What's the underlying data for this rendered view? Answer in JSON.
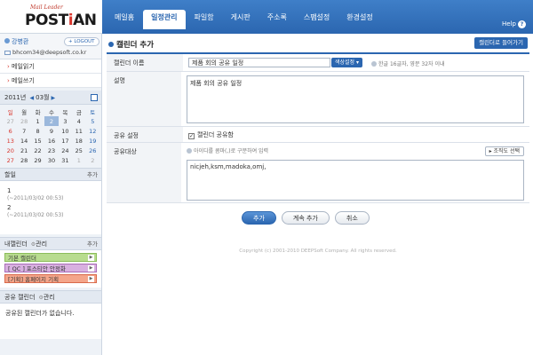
{
  "brand": {
    "tagline": "Mail Leader",
    "name_part1": "POST",
    "name_part2": "i",
    "name_part3": "AN"
  },
  "nav": {
    "items": [
      "메일홈",
      "일정관리",
      "파일함",
      "게시판",
      "주소록",
      "스팸설정",
      "환경설정"
    ],
    "active": "일정관리",
    "help": "Help"
  },
  "user": {
    "name": "강병환",
    "logout": "LOGOUT",
    "email": "bhcom34@deepsoft.co.kr"
  },
  "sidebar": {
    "links": [
      "메일읽기",
      "메일쓰기"
    ],
    "calendar": {
      "year": "2011년",
      "month": "03월",
      "weekdays": [
        "일",
        "월",
        "화",
        "수",
        "목",
        "금",
        "토"
      ],
      "weeks": [
        [
          "27",
          "28",
          "1",
          "2",
          "3",
          "4",
          "5"
        ],
        [
          "6",
          "7",
          "8",
          "9",
          "10",
          "11",
          "12"
        ],
        [
          "13",
          "14",
          "15",
          "16",
          "17",
          "18",
          "19"
        ],
        [
          "20",
          "21",
          "22",
          "23",
          "24",
          "25",
          "26"
        ],
        [
          "27",
          "28",
          "29",
          "30",
          "31",
          "1",
          "2"
        ]
      ]
    },
    "todo": {
      "title": "할일",
      "more": "추가",
      "items": [
        {
          "num": "1",
          "time": "(~2011/03/02 00:53)"
        },
        {
          "num": "2",
          "time": "(~2011/03/02 00:53)"
        }
      ]
    },
    "my_calendars": {
      "title": "내캘린더",
      "manage": "관리",
      "more": "추가",
      "items": [
        {
          "label": "기본 캘린더",
          "color": "#9fcf6b"
        },
        {
          "label": "[ QC ] 포스티안 안정화",
          "color": "#c58ad1"
        },
        {
          "label": "[기획] 홈페이지 기획",
          "color": "#f08a6a"
        }
      ]
    },
    "shared": {
      "title": "공유 캘린더",
      "manage": "관리",
      "empty": "공유된 캘린더가 없습니다."
    }
  },
  "main": {
    "title": "캘린더 추가",
    "import_button": "캘린더로 들어가기",
    "form": {
      "name_label": "캘린더 이름",
      "name_value": "제품 회의 공유 일정",
      "color_button": "색상설정 ▾",
      "name_hint": "한글 16글자, 영문 32자 이내",
      "desc_label": "설명",
      "desc_value": "제품 회의 공유 일정",
      "share_label": "공유 설정",
      "share_check": "캘린더 공유함",
      "target_label": "공유대상",
      "target_hint": "아이디를 콤마(,)로 구분하여 입력",
      "org_button": "▸ 조직도 선택",
      "target_value": "nicjeh,ksm,madoka,omj,"
    },
    "buttons": {
      "add": "추가",
      "continue": "계속 추가",
      "cancel": "취소"
    },
    "copyright": "Copyright (c) 2001-2010 DEEPSoft Company.  All rights reserved."
  }
}
